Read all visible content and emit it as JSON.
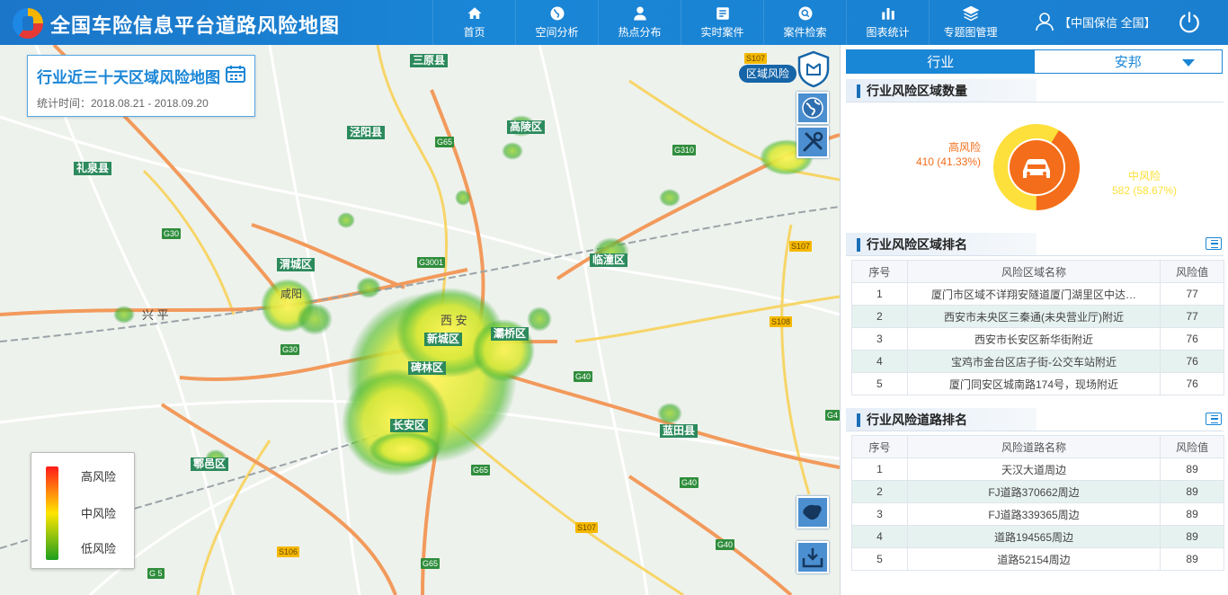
{
  "header": {
    "title": "全国车险信息平台道路风险地图",
    "nav": [
      {
        "label": "首页",
        "icon": "home-icon"
      },
      {
        "label": "空间分析",
        "icon": "globe-icon"
      },
      {
        "label": "热点分布",
        "icon": "location-pin-icon"
      },
      {
        "label": "实时案件",
        "icon": "document-icon"
      },
      {
        "label": "案件检索",
        "icon": "search-icon"
      },
      {
        "label": "图表统计",
        "icon": "bar-chart-icon"
      },
      {
        "label": "专题图管理",
        "icon": "layers-icon"
      }
    ],
    "user": "【中国保信 全国】"
  },
  "map": {
    "title": "行业近三十天区域风险地图",
    "subtitle": "统计时间：2018.08.21 - 2018.09.20",
    "region_tag": "区域风险",
    "legend": {
      "high": "高风险",
      "mid": "中风险",
      "low": "低风险"
    },
    "labels": {
      "sanyuan": "三原县",
      "jingyang": "泾阳县",
      "gaoling": "高陵区",
      "liquan": "礼泉县",
      "weicheng": "渭城区",
      "xianyang": "咸阳",
      "xingping": "兴 平",
      "xian": "西 安",
      "xincheng": "新城区",
      "baqiao": "灞桥区",
      "beilin": "碑林区",
      "changan": "长安区",
      "lintong": "临潼区",
      "lantian": "蓝田县",
      "huyi": "鄠邑区"
    },
    "roads": {
      "g65a": "G65",
      "g30a": "G30",
      "g30b": "G30",
      "g310": "G310",
      "s107a": "S107",
      "s107b": "S107",
      "s108": "S108",
      "g40a": "G40",
      "g40b": "G40",
      "g40c": "G40",
      "g65b": "G65",
      "g65c": "G65",
      "s106": "S106",
      "g5": "G 5",
      "g3001": "G3001",
      "g4": "G4"
    }
  },
  "panel": {
    "tabs": {
      "industry": "行业",
      "company": "安邦"
    },
    "count_section": "行业风险区域数量",
    "donut": {
      "high_label": "高风险",
      "high_value": "410 (41.33%)",
      "mid_label": "中风险",
      "mid_value": "582 (58.67%)",
      "high_pct": 41.33,
      "mid_pct": 58.67,
      "high_color": "#f46d1a",
      "mid_color": "#fde03b"
    },
    "area_rank": {
      "title": "行业风险区域排名",
      "headers": [
        "序号",
        "风险区域名称",
        "风险值"
      ],
      "rows": [
        [
          "1",
          "厦门市区域不详翔安隧道厦门湖里区中达…",
          "77"
        ],
        [
          "2",
          "西安市未央区三秦通(未央营业厅)附近",
          "77"
        ],
        [
          "3",
          "西安市长安区新华街附近",
          "76"
        ],
        [
          "4",
          "宝鸡市金台区店子街-公交车站附近",
          "76"
        ],
        [
          "5",
          "厦门同安区城南路174号，现场附近",
          "76"
        ]
      ]
    },
    "road_rank": {
      "title": "行业风险道路排名",
      "headers": [
        "序号",
        "风险道路名称",
        "风险值"
      ],
      "rows": [
        [
          "1",
          "天汉大道周边",
          "89"
        ],
        [
          "2",
          "FJ道路370662周边",
          "89"
        ],
        [
          "3",
          "FJ道路339365周边",
          "89"
        ],
        [
          "4",
          "道路194565周边",
          "89"
        ],
        [
          "5",
          "道路52154周边",
          "89"
        ]
      ]
    }
  }
}
